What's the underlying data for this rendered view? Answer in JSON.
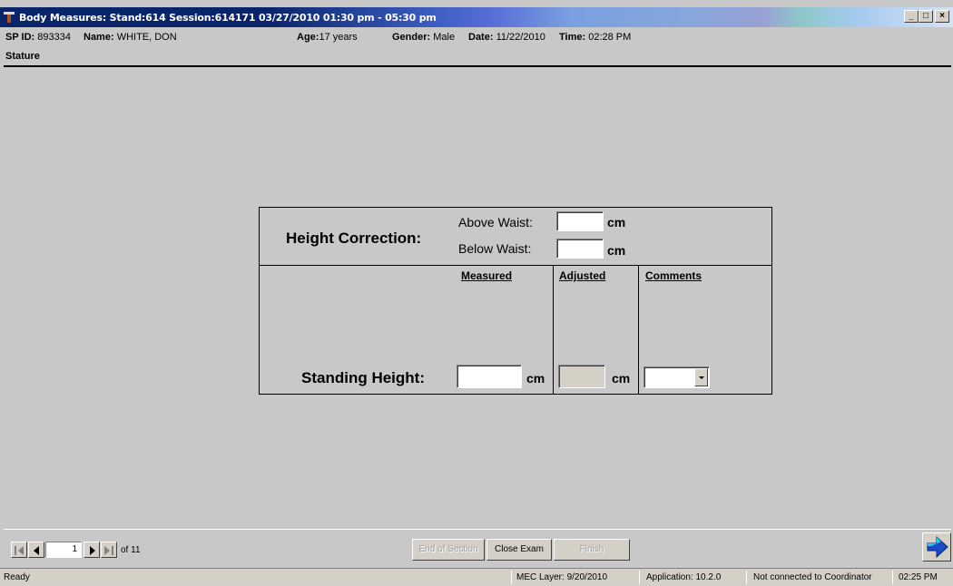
{
  "window": {
    "title": "Body Measures: Stand:614 Session:614171 03/27/2010 01:30 pm - 05:30 pm",
    "min_btn": "_",
    "max_btn": "□",
    "close_btn": "×"
  },
  "header": {
    "spid_label": "SP ID:",
    "spid_value": "893334",
    "name_label": "Name:",
    "name_value": "WHITE, DON",
    "age_label": "Age:",
    "age_value": "17 years",
    "gender_label": "Gender:",
    "gender_value": "Male",
    "date_label": "Date:",
    "date_value": "11/22/2010",
    "time_label": "Time:",
    "time_value": "02:28 PM"
  },
  "section": {
    "title": "Stature"
  },
  "form": {
    "height_correction_label": "Height Correction:",
    "above_waist_label": "Above Waist:",
    "above_waist_value": "",
    "below_waist_label": "Below Waist:",
    "below_waist_value": "",
    "unit": "cm",
    "col_measured": "Measured",
    "col_adjusted": "Adjusted",
    "col_comments": "Comments",
    "standing_height_label": "Standing Height:",
    "measured_value": "",
    "adjusted_value": "",
    "comments_value": ""
  },
  "navigation": {
    "page": "1",
    "of_label": "of 11",
    "end_of_section": "End of Section",
    "close_exam": "Close Exam",
    "finish": "Finish"
  },
  "status": {
    "ready": "Ready",
    "mec_layer": "MEC Layer: 9/20/2010",
    "application": "Application: 10.2.0",
    "coordinator": "Not connected to Coordinator",
    "clock": "02:25 PM"
  }
}
